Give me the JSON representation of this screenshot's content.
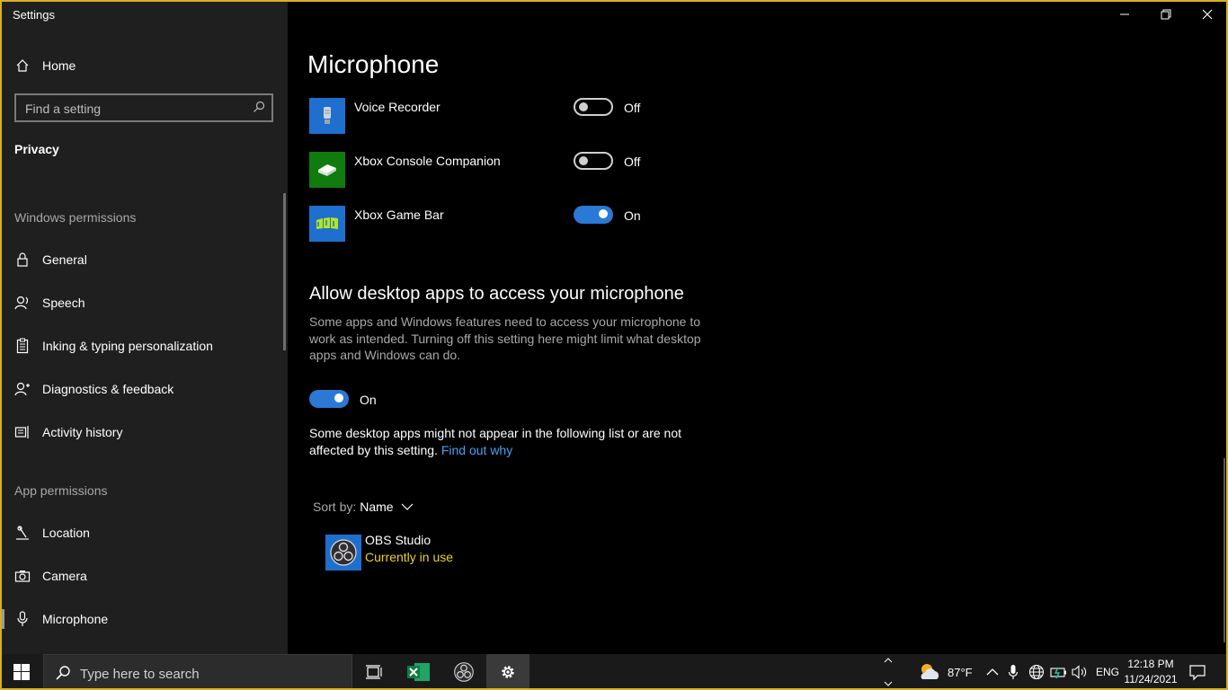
{
  "window": {
    "title": "Settings"
  },
  "sidebar": {
    "home_label": "Home",
    "search_placeholder": "Find a setting",
    "current_section": "Privacy",
    "windows_permissions_header": "Windows permissions",
    "windows_permissions": [
      {
        "label": "General",
        "icon": "lock-icon"
      },
      {
        "label": "Speech",
        "icon": "speech-icon"
      },
      {
        "label": "Inking & typing personalization",
        "icon": "clipboard-icon"
      },
      {
        "label": "Diagnostics & feedback",
        "icon": "diagnostics-icon"
      },
      {
        "label": "Activity history",
        "icon": "activity-history-icon"
      }
    ],
    "app_permissions_header": "App permissions",
    "app_permissions": [
      {
        "label": "Location",
        "icon": "location-icon"
      },
      {
        "label": "Camera",
        "icon": "camera-icon"
      },
      {
        "label": "Microphone",
        "icon": "microphone-icon",
        "selected": true
      }
    ]
  },
  "main": {
    "title": "Microphone",
    "apps": [
      {
        "name": "Voice Recorder",
        "state": "Off",
        "icon_color": "#1e6fce"
      },
      {
        "name": "Xbox Console Companion",
        "state": "Off",
        "icon_color": "#107c10"
      },
      {
        "name": "Xbox Game Bar",
        "state": "On",
        "icon_color": "#1e6fce"
      }
    ],
    "desktop_heading": "Allow desktop apps to access your microphone",
    "desktop_description": "Some apps and Windows features need to access your microphone to work as intended. Turning off this setting here might limit what desktop apps and Windows can do.",
    "desktop_toggle_state": "On",
    "desktop_note": "Some desktop apps might not appear in the following list or are not affected by this setting.",
    "find_out_link": "Find out why",
    "sort_label": "Sort by:",
    "sort_value": "Name",
    "desktop_apps": [
      {
        "name": "OBS Studio",
        "status": "Currently in use"
      }
    ]
  },
  "taskbar": {
    "search_placeholder": "Type here to search",
    "weather": "87°F",
    "language": "ENG",
    "time": "12:18 PM",
    "date": "11/24/2021"
  },
  "colors": {
    "accent": "#2b79d6",
    "link": "#4aa0f0",
    "in_use": "#e8d31c",
    "window_border": "#d8b021"
  }
}
